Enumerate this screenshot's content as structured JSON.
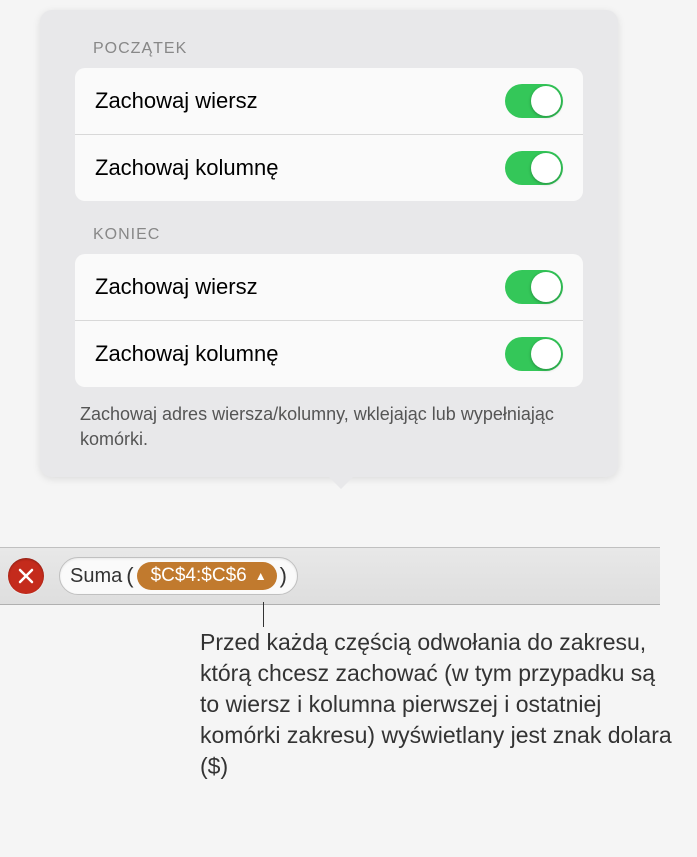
{
  "popover": {
    "sections": [
      {
        "header": "Początek",
        "rows": [
          {
            "label": "Zachowaj wiersz",
            "on": true
          },
          {
            "label": "Zachowaj kolumnę",
            "on": true
          }
        ]
      },
      {
        "header": "Koniec",
        "rows": [
          {
            "label": "Zachowaj wiersz",
            "on": true
          },
          {
            "label": "Zachowaj kolumnę",
            "on": true
          }
        ]
      }
    ],
    "help_text": "Zachowaj adres wiersza/kolumny, wklejając lub wypełniając komórki."
  },
  "formula": {
    "function_name": "Suma",
    "range": "$C$4:$C$6"
  },
  "callout": "Przed każdą częścią odwołania do zakresu, którą chcesz zachować (w tym przypadku są to wiersz i kolumna pierwszej i ostatniej komórki zakresu) wyświetlany jest znak dolara ($)"
}
